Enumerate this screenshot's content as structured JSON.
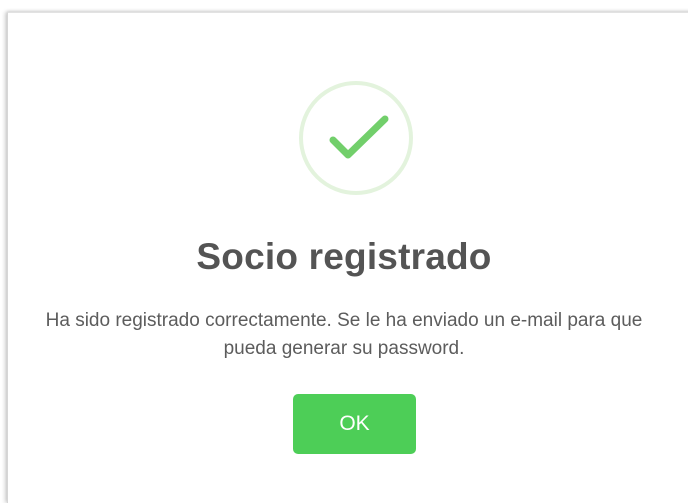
{
  "dialog": {
    "icon": "check-icon",
    "title": "Socio registrado",
    "message": "Ha sido registrado correctamente. Se le ha enviado un e-mail para que pueda generar su password.",
    "ok_label": "OK"
  },
  "colors": {
    "check": "#72cf6b",
    "ring": "#e3f3dd",
    "button": "#4dce57",
    "title": "#545454",
    "message": "#5c5c5c"
  }
}
